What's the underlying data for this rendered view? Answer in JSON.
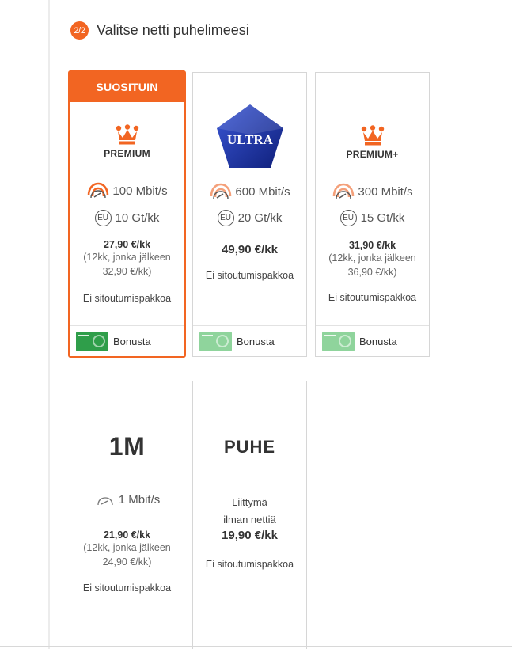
{
  "header": {
    "step_badge": "2/2",
    "title": "Valitse netti puhelimeesi"
  },
  "colors": {
    "accent": "#f26522",
    "ultra_blue": "#1b2f9e",
    "bonus_green": "#2f9e4a"
  },
  "plans": [
    {
      "id": "premium",
      "ribbon": "SUOSITUIN",
      "name": "PREMIUM",
      "icon": "crown-icon",
      "speed": "100 Mbit/s",
      "eu_label": "EU",
      "eu_data": "10 Gt/kk",
      "price": "27,90 €/kk",
      "price_note_1": "(12kk, jonka jälkeen",
      "price_note_2": "32,90 €/kk)",
      "commitment": "Ei sitoutumispakkoa",
      "bonus": "Bonusta",
      "selected": true
    },
    {
      "id": "ultra",
      "name": "ULTRA",
      "icon": "pentagon-logo",
      "speed": "600 Mbit/s",
      "eu_label": "EU",
      "eu_data": "20 Gt/kk",
      "price": "49,90 €/kk",
      "commitment": "Ei sitoutumispakkoa",
      "bonus": "Bonusta"
    },
    {
      "id": "premium-plus",
      "name": "PREMIUM+",
      "icon": "crown-icon",
      "speed": "300 Mbit/s",
      "eu_label": "EU",
      "eu_data": "15 Gt/kk",
      "price": "31,90 €/kk",
      "price_note_1": "(12kk, jonka jälkeen",
      "price_note_2": "36,90 €/kk)",
      "commitment": "Ei sitoutumispakkoa",
      "bonus": "Bonusta"
    },
    {
      "id": "1m",
      "name": "1M",
      "speed": "1 Mbit/s",
      "price": "21,90 €/kk",
      "price_note_1": "(12kk, jonka jälkeen",
      "price_note_2": "24,90 €/kk)",
      "commitment": "Ei sitoutumispakkoa"
    },
    {
      "id": "puhe",
      "name": "PUHE",
      "line_1": "Liittymä",
      "line_2": "ilman nettiä",
      "price": "19,90 €/kk",
      "commitment": "Ei sitoutumispakkoa"
    }
  ]
}
